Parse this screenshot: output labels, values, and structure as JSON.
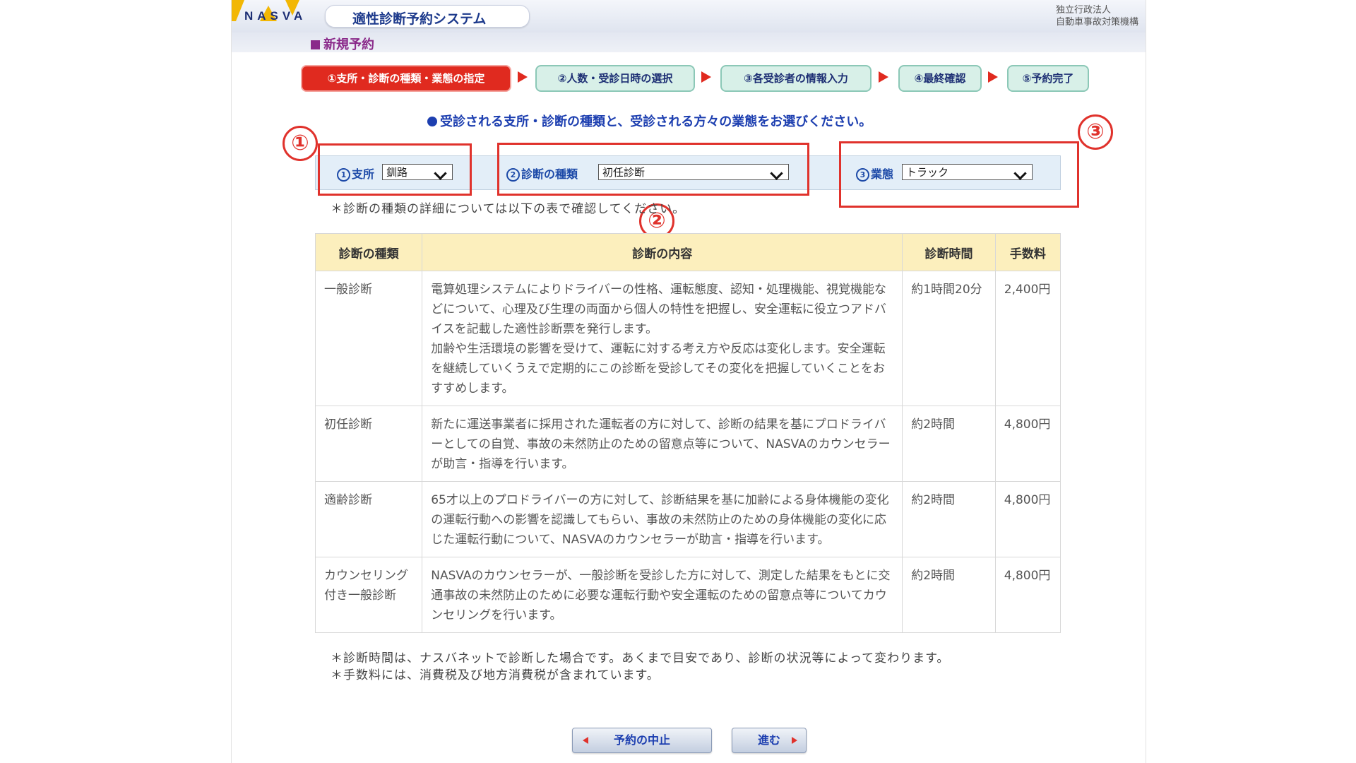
{
  "header": {
    "logo_text": "NASVA",
    "system_title": "適性診断予約システム",
    "org_line1": "独立行政法人",
    "org_line2": "自動車事故対策機構"
  },
  "section_title": "新規予約",
  "steps": [
    {
      "label": "①支所・診断の種類・業態の指定",
      "active": true
    },
    {
      "label": "②人数・受診日時の選択",
      "active": false
    },
    {
      "label": "③各受診者の情報入力",
      "active": false
    },
    {
      "label": "④最終確認",
      "active": false
    },
    {
      "label": "⑤予約完了",
      "active": false
    }
  ],
  "instruction": "受診される支所・診断の種類と、受診される方々の業態をお選びください。",
  "selectors": {
    "branch": {
      "num": "1",
      "label": "支所",
      "value": "釧路"
    },
    "diagnosis_type": {
      "num": "2",
      "label": "診断の種類",
      "value": "初任診断"
    },
    "business_type": {
      "num": "3",
      "label": "業態",
      "value": "トラック"
    }
  },
  "callouts": [
    "①",
    "②",
    "③"
  ],
  "note_top": "＊診断の種類の詳細については以下の表で確認してください。",
  "table": {
    "headers": [
      "診断の種類",
      "診断の内容",
      "診断時間",
      "手数料"
    ],
    "rows": [
      {
        "type": "一般診断",
        "content": "電算処理システムによりドライバーの性格、運転態度、認知・処理機能、視覚機能などについて、心理及び生理の両面から個人の特性を把握し、安全運転に役立つアドバイスを記載した適性診断票を発行します。",
        "content2": "加齢や生活環境の影響を受けて、運転に対する考え方や反応は変化します。安全運転を継続していくうえで定期的にこの診断を受診してその変化を把握していくことをおすすめします。",
        "time": "約1時間20分",
        "fee": "2,400円"
      },
      {
        "type": "初任診断",
        "content": "新たに運送事業者に採用された運転者の方に対して、診断の結果を基にプロドライバーとしての自覚、事故の未然防止のための留意点等について、NASVAのカウンセラーが助言・指導を行います。",
        "content2": "",
        "time": "約2時間",
        "fee": "4,800円"
      },
      {
        "type": "適齢診断",
        "content": "65才以上のプロドライバーの方に対して、診断結果を基に加齢による身体機能の変化の運転行動への影響を認識してもらい、事故の未然防止のための身体機能の変化に応じた運転行動について、NASVAのカウンセラーが助言・指導を行います。",
        "content2": "",
        "time": "約2時間",
        "fee": "4,800円"
      },
      {
        "type": "カウンセリング付き一般診断",
        "content": "NASVAのカウンセラーが、一般診断を受診した方に対して、測定した結果をもとに交通事故の未然防止のために必要な運転行動や安全運転のための留意点等についてカウンセリングを行います。",
        "content2": "",
        "time": "約2時間",
        "fee": "4,800円"
      }
    ]
  },
  "footnote1": "＊診断時間は、ナスバネットで診断した場合です。あくまで目安であり、診断の状況等によって変わります。",
  "footnote2": "＊手数料には、消費税及び地方消費税が含まれています。",
  "buttons": {
    "cancel": "予約の中止",
    "next": "進む"
  },
  "colors": {
    "accent_red": "#e02a1f",
    "brand_blue": "#1d3fb0",
    "header_purple": "#8a2a8a",
    "table_header": "#fcefbd"
  }
}
